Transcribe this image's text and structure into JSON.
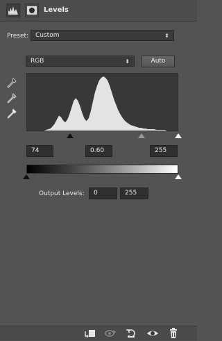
{
  "header": {
    "title": "Levels",
    "icons": [
      "levels-adjustment-icon",
      "layer-mask-icon"
    ]
  },
  "preset": {
    "label": "Preset:",
    "value": "Custom"
  },
  "channel": {
    "value": "RGB"
  },
  "auto_button": {
    "label": "Auto"
  },
  "eyedroppers": [
    "black-point-eyedropper-icon",
    "gray-point-eyedropper-icon",
    "white-point-eyedropper-icon"
  ],
  "input_levels": {
    "shadows": "74",
    "midtones": "0.60",
    "highlights": "255",
    "shadows_value": 74,
    "midtones_value": 0.6,
    "highlights_value": 255
  },
  "output_levels": {
    "label": "Output Levels:",
    "low": "0",
    "high": "255",
    "low_value": 0,
    "high_value": 255
  },
  "histogram": {
    "bins": [
      0,
      0,
      0,
      0,
      0,
      0,
      0,
      0,
      0,
      1,
      2,
      3,
      6,
      10,
      16,
      22,
      20,
      15,
      12,
      16,
      24,
      34,
      44,
      48,
      44,
      36,
      26,
      18,
      14,
      18,
      28,
      42,
      56,
      66,
      74,
      78,
      80,
      78,
      74,
      66,
      56,
      46,
      38,
      30,
      24,
      19,
      15,
      12,
      10,
      8,
      7,
      6,
      5,
      4,
      4,
      3,
      3,
      2,
      2,
      2,
      2,
      1,
      1,
      1,
      1,
      1,
      0,
      0,
      0,
      0,
      0,
      0
    ]
  },
  "footer": {
    "icons": [
      "clip-to-layer-icon",
      "view-previous-state-icon",
      "reset-icon",
      "visibility-eye-icon",
      "delete-trash-icon"
    ]
  },
  "colors": {
    "panel_bg": "#535353",
    "field_bg": "#2f2f2f",
    "histogram_fill": "#e3e3e3"
  }
}
